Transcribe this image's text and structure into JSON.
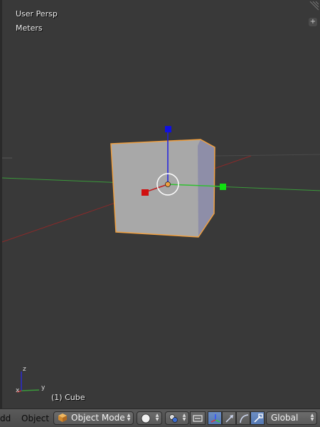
{
  "viewport": {
    "view_name": "User Persp",
    "units": "Meters",
    "object_info": "(1) Cube",
    "mini_axes": {
      "z": "z",
      "y": "y",
      "x": "x"
    }
  },
  "header": {
    "add_menu": "dd",
    "object_menu": "Object",
    "mode_select": "Object Mode",
    "orientation_select": "Global"
  },
  "colors": {
    "viewport_bg": "#393939",
    "x_axis": "#9b2a2a",
    "y_axis": "#3a9a3a",
    "z_axis": "#1010e0",
    "selection_outline": "#f0a040",
    "active_blue": "#5478b3"
  },
  "icons": {
    "cube": "cube-icon",
    "shading": "solid-sphere-icon",
    "pivot": "pivot-point-icon",
    "snap": "snap-icon",
    "manipulator": "manipulator-icon",
    "translate": "translate-arrow-icon",
    "rotate": "rotate-arc-icon",
    "scale": "scale-icon"
  }
}
